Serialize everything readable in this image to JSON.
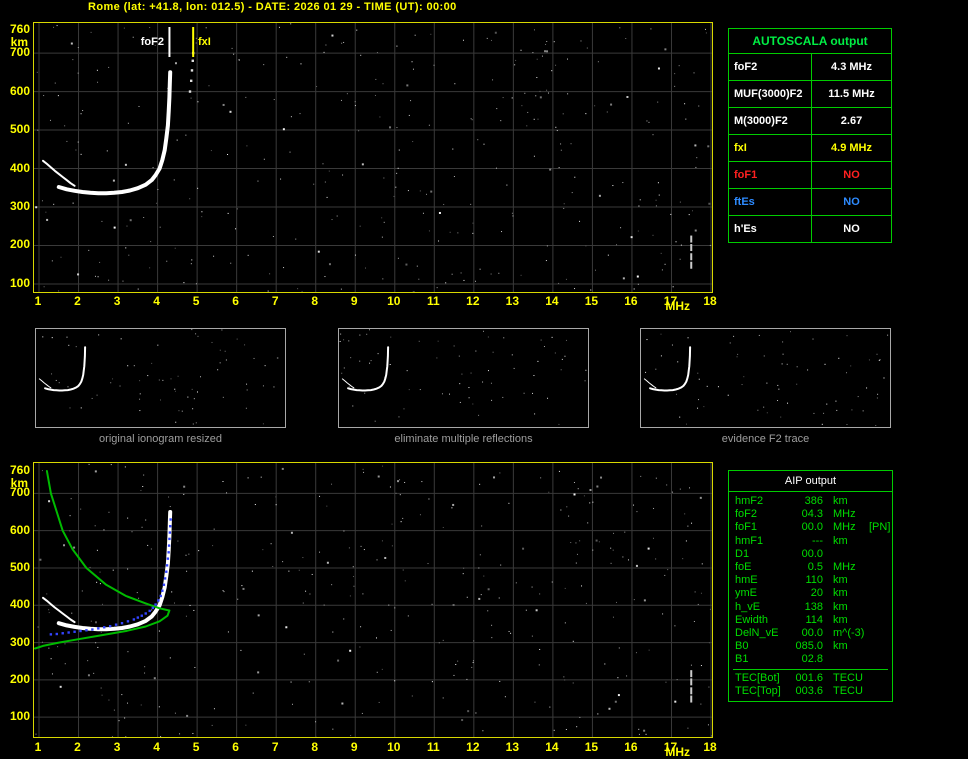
{
  "window": {
    "title": "Rome (lat: +41.8, lon: 012.5) - DATE: 2026 01 29 - TIME (UT): 00:00"
  },
  "colors": {
    "background": "#000000",
    "plot_frame_yellow": "#d8d800",
    "grid_gray": "#3a3a3a",
    "axis_label_yellow": "#ffff00",
    "table_green": "#00cc00",
    "trace_white": "#ffffff",
    "profile_green": "#00bb00",
    "restored_trace_blue": "#3344ff",
    "caption_gray": "#9e9e9e",
    "no_red": "#ff2020",
    "no_blue": "#2e8bff"
  },
  "autoscala": {
    "title": "AUTOSCALA output",
    "rows": [
      {
        "label": "foF2",
        "value": "4.3 MHz",
        "color": "#ffffff"
      },
      {
        "label": "MUF(3000)F2",
        "value": "11.5 MHz",
        "color": "#ffffff"
      },
      {
        "label": "M(3000)F2",
        "value": "2.67",
        "color": "#ffffff"
      },
      {
        "label": "fxI",
        "value": "4.9 MHz",
        "color": "#ffff00"
      },
      {
        "label": "foF1",
        "value": "NO",
        "color": "#ff2020"
      },
      {
        "label": "ftEs",
        "value": "NO",
        "color": "#2e8bff"
      },
      {
        "label": "h'Es",
        "value": "NO",
        "color": "#ffffff"
      }
    ]
  },
  "thumbnails": [
    {
      "caption": "original ionogram resized"
    },
    {
      "caption": "eliminate multiple reflections"
    },
    {
      "caption": "evidence F2 trace"
    }
  ],
  "aip": {
    "title": "AIP output",
    "rows": [
      {
        "name": "hmF2",
        "value": "386",
        "unit": "km",
        "note": ""
      },
      {
        "name": "foF2",
        "value": "04.3",
        "unit": "MHz",
        "note": ""
      },
      {
        "name": "foF1",
        "value": "00.0",
        "unit": "MHz",
        "note": "[PN]"
      },
      {
        "name": "hmF1",
        "value": "---",
        "unit": "km",
        "note": ""
      },
      {
        "name": "D1",
        "value": "00.0",
        "unit": "",
        "note": ""
      },
      {
        "name": "foE",
        "value": "0.5",
        "unit": "MHz",
        "note": ""
      },
      {
        "name": "hmE",
        "value": "110",
        "unit": "km",
        "note": ""
      },
      {
        "name": "ymE",
        "value": "20",
        "unit": "km",
        "note": ""
      },
      {
        "name": "h_vE",
        "value": "138",
        "unit": "km",
        "note": ""
      },
      {
        "name": "Ewidth",
        "value": "114",
        "unit": "km",
        "note": ""
      },
      {
        "name": "DelN_vE",
        "value": "00.0",
        "unit": "m^(-3)",
        "note": ""
      },
      {
        "name": "B0",
        "value": "085.0",
        "unit": "km",
        "note": ""
      },
      {
        "name": "B1",
        "value": "02.8",
        "unit": "",
        "note": ""
      },
      {
        "name": "TEC[Bot]",
        "value": "001.6",
        "unit": "TECU",
        "note": "",
        "sep_above": true
      },
      {
        "name": "TEC[Top]",
        "value": "003.6",
        "unit": "TECU",
        "note": ""
      }
    ]
  },
  "chart_data": [
    {
      "type": "scatter",
      "title": "Ionogram with Autoscala scaled characteristics (top panel)",
      "xlabel": "MHz",
      "ylabel": "km",
      "xlim": [
        1,
        18
      ],
      "ylim": [
        100,
        760
      ],
      "grid": true,
      "x_ticks": [
        1,
        2,
        3,
        4,
        5,
        6,
        7,
        8,
        9,
        10,
        11,
        12,
        13,
        14,
        15,
        16,
        17,
        18
      ],
      "y_ticks": [
        760,
        700,
        600,
        500,
        400,
        300,
        200,
        100
      ],
      "markers": {
        "foF2_MHz": 4.3,
        "fxI_MHz": 4.9
      },
      "marker_labels": {
        "foF2": "foF2",
        "fxI": "fxI"
      },
      "series": [
        {
          "name": "leading-edge-branch",
          "color": "#ffffff",
          "width": 2,
          "x": [
            1.1,
            1.2,
            1.3,
            1.4,
            1.5,
            1.6,
            1.7,
            1.8,
            1.9
          ],
          "y": [
            420,
            412,
            403,
            394,
            386,
            378,
            370,
            362,
            355
          ]
        },
        {
          "name": "F2-trace",
          "color": "#ffffff",
          "width": 4,
          "x": [
            1.5,
            1.7,
            1.9,
            2.1,
            2.3,
            2.5,
            2.7,
            2.9,
            3.1,
            3.3,
            3.5,
            3.7,
            3.85,
            3.95,
            4.05,
            4.12,
            4.18,
            4.22,
            4.26,
            4.28,
            4.3,
            4.31,
            4.32
          ],
          "y": [
            352,
            346,
            342,
            339,
            337,
            336,
            336,
            337,
            339,
            343,
            349,
            358,
            370,
            383,
            400,
            422,
            448,
            478,
            512,
            548,
            585,
            620,
            650
          ]
        },
        {
          "name": "x-mode-trace",
          "color": "#e0e0e0",
          "width": 2,
          "style": "dots",
          "x": [
            4.82,
            4.85,
            4.87,
            4.89,
            4.9
          ],
          "y": [
            600,
            628,
            655,
            680,
            700
          ]
        },
        {
          "name": "interference-column",
          "color": "#cccccc",
          "width": 2,
          "style": "dashes",
          "x": [
            17.5,
            17.5,
            17.5,
            17.5
          ],
          "y": [
            150,
            172,
            196,
            218
          ]
        }
      ]
    },
    {
      "type": "scatter",
      "title": "Ionogram with restored trace and electron density profile (bottom panel)",
      "xlabel": "MHz",
      "ylabel": "km",
      "xlim": [
        1,
        18
      ],
      "ylim": [
        100,
        760
      ],
      "grid": true,
      "x_ticks": [
        1,
        2,
        3,
        4,
        5,
        6,
        7,
        8,
        9,
        10,
        11,
        12,
        13,
        14,
        15,
        16,
        17,
        18
      ],
      "y_ticks": [
        760,
        700,
        600,
        500,
        400,
        300,
        200,
        100
      ],
      "series": [
        {
          "name": "leading-edge-branch",
          "color": "#ffffff",
          "width": 2,
          "x": [
            1.1,
            1.2,
            1.3,
            1.4,
            1.5,
            1.6,
            1.7,
            1.8,
            1.9
          ],
          "y": [
            420,
            412,
            403,
            394,
            386,
            378,
            370,
            362,
            355
          ]
        },
        {
          "name": "F2-trace",
          "color": "#ffffff",
          "width": 4,
          "x": [
            1.5,
            1.7,
            1.9,
            2.1,
            2.3,
            2.5,
            2.7,
            2.9,
            3.1,
            3.3,
            3.5,
            3.7,
            3.85,
            3.95,
            4.05,
            4.12,
            4.18,
            4.22,
            4.26,
            4.28,
            4.3,
            4.31,
            4.32
          ],
          "y": [
            352,
            346,
            342,
            339,
            337,
            336,
            336,
            337,
            339,
            343,
            349,
            358,
            370,
            383,
            400,
            422,
            448,
            478,
            512,
            548,
            585,
            620,
            650
          ]
        },
        {
          "name": "electron-density-profile",
          "color": "#00bb00",
          "width": 2,
          "x": [
            1.2,
            1.3,
            1.45,
            1.6,
            1.85,
            2.2,
            2.7,
            3.2,
            3.7,
            4.05,
            4.25,
            4.3,
            4.25,
            4.05,
            3.7,
            3.2,
            2.6,
            2.0,
            1.5,
            1.1,
            0.9
          ],
          "y": [
            760,
            700,
            650,
            600,
            550,
            500,
            455,
            425,
            405,
            392,
            387,
            386,
            372,
            357,
            343,
            331,
            320,
            309,
            300,
            291,
            284
          ]
        },
        {
          "name": "restored-trace",
          "color": "#3344ff",
          "width": 2,
          "style": "dots",
          "x": [
            1.3,
            1.45,
            1.6,
            1.75,
            1.9,
            2.05,
            2.2,
            2.35,
            2.5,
            2.65,
            2.8,
            2.95,
            3.1,
            3.25,
            3.4,
            3.5,
            3.6,
            3.7,
            3.8,
            3.88,
            3.95,
            4.02,
            4.08,
            4.12,
            4.16,
            4.19,
            4.22,
            4.24,
            4.26,
            4.28,
            4.29,
            4.3,
            4.31,
            4.32,
            4.33
          ],
          "y": [
            322,
            323,
            325,
            327,
            329,
            331,
            333,
            335,
            338,
            341,
            344,
            348,
            352,
            357,
            362,
            367,
            372,
            378,
            385,
            393,
            402,
            413,
            425,
            439,
            455,
            472,
            490,
            507,
            525,
            542,
            560,
            578,
            595,
            612,
            630
          ]
        },
        {
          "name": "interference-column",
          "color": "#cccccc",
          "width": 2,
          "style": "dashes",
          "x": [
            17.5,
            17.5,
            17.5,
            17.5
          ],
          "y": [
            150,
            172,
            196,
            218
          ]
        }
      ]
    }
  ]
}
